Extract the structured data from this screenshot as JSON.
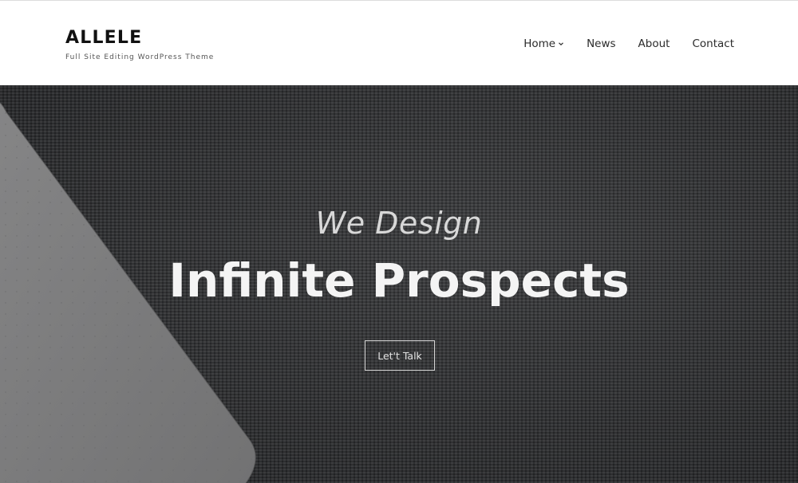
{
  "header": {
    "site_title": "ALLELE",
    "tagline": "Full Site Editing WordPress Theme",
    "nav": [
      {
        "label": "Home",
        "has_submenu": true,
        "icon": "chevron-down-icon"
      },
      {
        "label": "News",
        "has_submenu": false
      },
      {
        "label": "About",
        "has_submenu": false
      },
      {
        "label": "Contact",
        "has_submenu": false
      }
    ]
  },
  "hero": {
    "kicker": "We Design",
    "title": "Infinite Prospects",
    "cta_label": "Let't Talk",
    "background": "dark woven fabric texture with grey notebook corner",
    "colors": {
      "fabric": "#2e2f31",
      "notebook": "#7a7a7b",
      "text": "#f4f4f4"
    }
  }
}
